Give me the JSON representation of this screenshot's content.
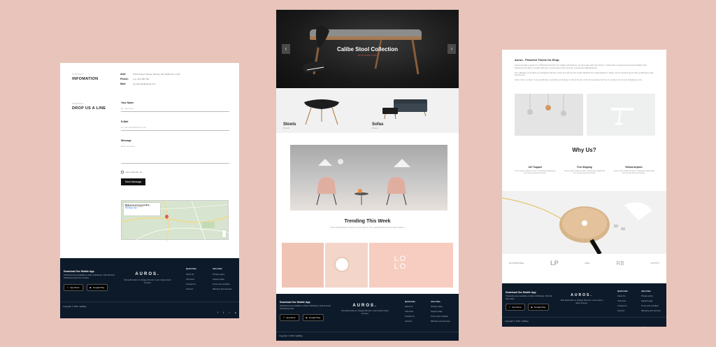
{
  "left": {
    "info_small": "CONTACT",
    "info_title": "INFOMATION",
    "addr_key": "Add:",
    "addr_val": "1234 Heaven Stress, Beverly Hill, Melbourne, USA",
    "phone_key": "Phone:",
    "phone_val": "(+1) 123 456 789",
    "mail_key": "Mail:",
    "mail_val": "yourdomain@gmail.com",
    "drop_small": "CONTACT",
    "drop_title": "DROP US A LINE",
    "name_label": "Your Name",
    "name_ph": "Ex. John Doe",
    "email_label": "E-Mail",
    "email_ph": "Ex. john.doe@domain.com",
    "msg_label": "Message",
    "msg_ph": "Enter text here...",
    "subscribe": "Also subscribe us",
    "send_btn": "Send Message",
    "map_card_title": "Melbourne and surrounding",
    "map_card_text": "Melbourne VIC, Australia",
    "map_card_link": "View larger map",
    "footer": {
      "app_title": "Download Our Mobile App",
      "app_text": "Photoshop tool available on Mac & Windows. Find the best Photoshop tools from creator.",
      "appstore": "App Store",
      "googleplay": "Google Play",
      "logo": "AUROS.",
      "logo_text": "Find add button to change this text. Lorem ipsum dolor sit amet.",
      "quick_title": "Quick links",
      "quick": [
        "About Us",
        "Visit store",
        "Contact Us",
        "Account"
      ],
      "jobs_title": "Jobs links",
      "jobs": [
        "Privacy policy",
        "Support page",
        "Terms and condition",
        "Warranty and services"
      ],
      "copyright": "Copyright © 2020, VijaBlog"
    }
  },
  "mid": {
    "hero_title": "Calibe Stool Collection",
    "hero_cta": "DISCOVER NOW",
    "cat1_name": "Stools",
    "cat1_sub": "8 items",
    "cat2_name": "Sofas",
    "cat2_sub": "8 items",
    "trend_title": "Trending This Week",
    "trend_sub": "This is Photoshop's version of Lorem Ipsum. Proin gravida nibh vel velit auctor aliquet.",
    "lolo_text": "LO LO",
    "footer": {
      "app_title": "Download Our Mobile App",
      "app_text": "Photoshop tool available on Mac & Windows. Find the best Photoshop tools.",
      "appstore": "App Store",
      "googleplay": "Google Play",
      "logo": "AUROS.",
      "logo_text": "Find add button to change this text. Lorem ipsum dolor sit amet.",
      "quick_title": "Quick links",
      "quick": [
        "About Us",
        "Visit store",
        "Contact Us",
        "Account"
      ],
      "jobs_title": "Jobs links",
      "jobs": [
        "Privacy policy",
        "Support page",
        "Terms and condition",
        "Warranty and services"
      ],
      "copyright": "Copyright © 2020, VijaBlog"
    }
  },
  "right": {
    "title": "Auros - Powerful Theme for Shop",
    "para1": "Auros provides a good mix of Magento Premium for quality and features, we have also write Our Vision. I could write a sample and recommendation that Tokenized and fast is a really high level. Lorem ipsum dolor sit amet, consectetur adipiscing elit.",
    "para2": "Our collection of products are designed and they come from all over the world. Whether from Scandinavia or Japan, all our furniture items have a distinctive style that we love.",
    "para3": "Send, Open, to shop. If you would like to purchase something or call us for any of the items please feel free to contact one of us at info@auros.com.",
    "why_title": "Why Us?",
    "feat1_title": "24/7 Support",
    "feat1_text": "Lorem ipsum dolor sit amet, consectetur adipiscing elit, sed do eiusmod tempor.",
    "feat2_title": "Free Shipping",
    "feat2_text": "Lorem ipsum dolor sit amet, consectetur adipiscing elit, sed do eiusmod tempor.",
    "feat3_title": "Refund Anytime",
    "feat3_text": "Lorem ipsum dolor sit amet, consectetur adipiscing elit, sed do eiusmod tempor.",
    "brands": [
      "BLOODBORNE",
      "LP",
      "IDEA",
      "RB",
      "HOTPOT"
    ],
    "footer": {
      "app_title": "Download Our Mobile App",
      "app_text": "Photoshop tool available on Mac & Windows. Find the best tools.",
      "appstore": "App Store",
      "googleplay": "Google Play",
      "logo": "AUROS.",
      "logo_text": "Find add button to change this text. Lorem ipsum dolor sit amet.",
      "quick_title": "Quick links",
      "quick": [
        "About Us",
        "Visit store",
        "Contact Us",
        "Account"
      ],
      "jobs_title": "Jobs links",
      "jobs": [
        "Privacy policy",
        "Support page",
        "Terms and condition",
        "Warranty and services"
      ],
      "copyright": "Copyright © 2020, VijaBlog"
    }
  },
  "colors": {
    "background": "#e8c4bb",
    "footer": "#0d1a2a",
    "accent": "#e25a4a"
  }
}
